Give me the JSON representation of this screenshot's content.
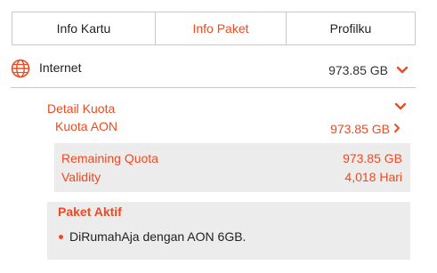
{
  "tabs": [
    {
      "label": "Info Kartu",
      "active": false
    },
    {
      "label": "Info Paket",
      "active": true
    },
    {
      "label": "Profilku",
      "active": false
    }
  ],
  "internet": {
    "label": "Internet",
    "value": "973.85 GB",
    "icon": "globe-icon"
  },
  "detail": {
    "title": "Detail Kuota",
    "kuota_label": "Kuota AON",
    "kuota_value": "973.85 GB",
    "remaining_label": "Remaining Quota",
    "remaining_value": "973.85 GB",
    "validity_label": "Validity",
    "validity_value": "4,018 Hari"
  },
  "paket": {
    "title": "Paket Aktif",
    "items": [
      "DiRumahAja dengan AON 6GB."
    ]
  },
  "colors": {
    "accent": "#ee4a22",
    "panel": "#ececec",
    "border": "#c8c8c8"
  }
}
